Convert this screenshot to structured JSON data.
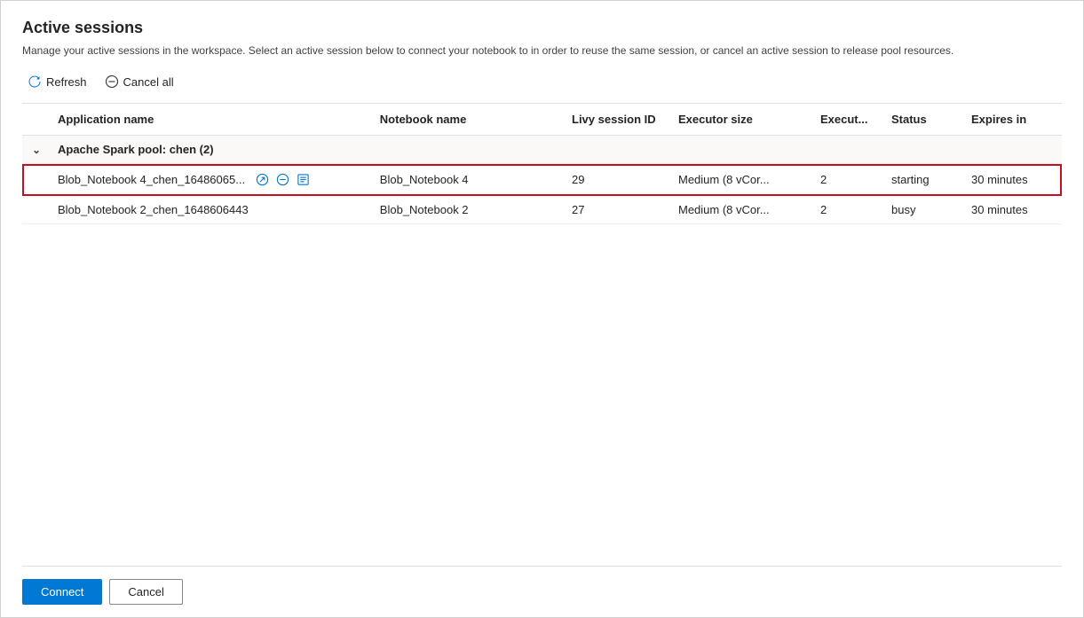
{
  "dialog": {
    "title": "Active sessions",
    "description": "Manage your active sessions in the workspace. Select an active session below to connect your notebook to in order to reuse the same session, or cancel an active session to release pool resources."
  },
  "toolbar": {
    "refresh_label": "Refresh",
    "cancel_all_label": "Cancel all"
  },
  "table": {
    "columns": [
      {
        "id": "expand",
        "label": ""
      },
      {
        "id": "appname",
        "label": "Application name"
      },
      {
        "id": "notebook",
        "label": "Notebook name"
      },
      {
        "id": "livy",
        "label": "Livy session ID"
      },
      {
        "id": "executor_size",
        "label": "Executor size"
      },
      {
        "id": "executor_count",
        "label": "Execut..."
      },
      {
        "id": "status",
        "label": "Status"
      },
      {
        "id": "expires",
        "label": "Expires in"
      }
    ],
    "groups": [
      {
        "name": "Apache Spark pool: chen (2)",
        "expanded": true,
        "rows": [
          {
            "app_name": "Blob_Notebook 4_chen_16486065...",
            "notebook_name": "Blob_Notebook 4",
            "livy_id": "29",
            "executor_size": "Medium (8 vCor...",
            "executor_count": "2",
            "status": "starting",
            "expires": "30 minutes",
            "selected": true,
            "actions": [
              "connect",
              "cancel",
              "logs"
            ]
          },
          {
            "app_name": "Blob_Notebook 2_chen_1648606443",
            "notebook_name": "Blob_Notebook 2",
            "livy_id": "27",
            "executor_size": "Medium (8 vCor...",
            "executor_count": "2",
            "status": "busy",
            "expires": "30 minutes",
            "selected": false,
            "actions": []
          }
        ]
      }
    ]
  },
  "footer": {
    "connect_label": "Connect",
    "cancel_label": "Cancel"
  }
}
